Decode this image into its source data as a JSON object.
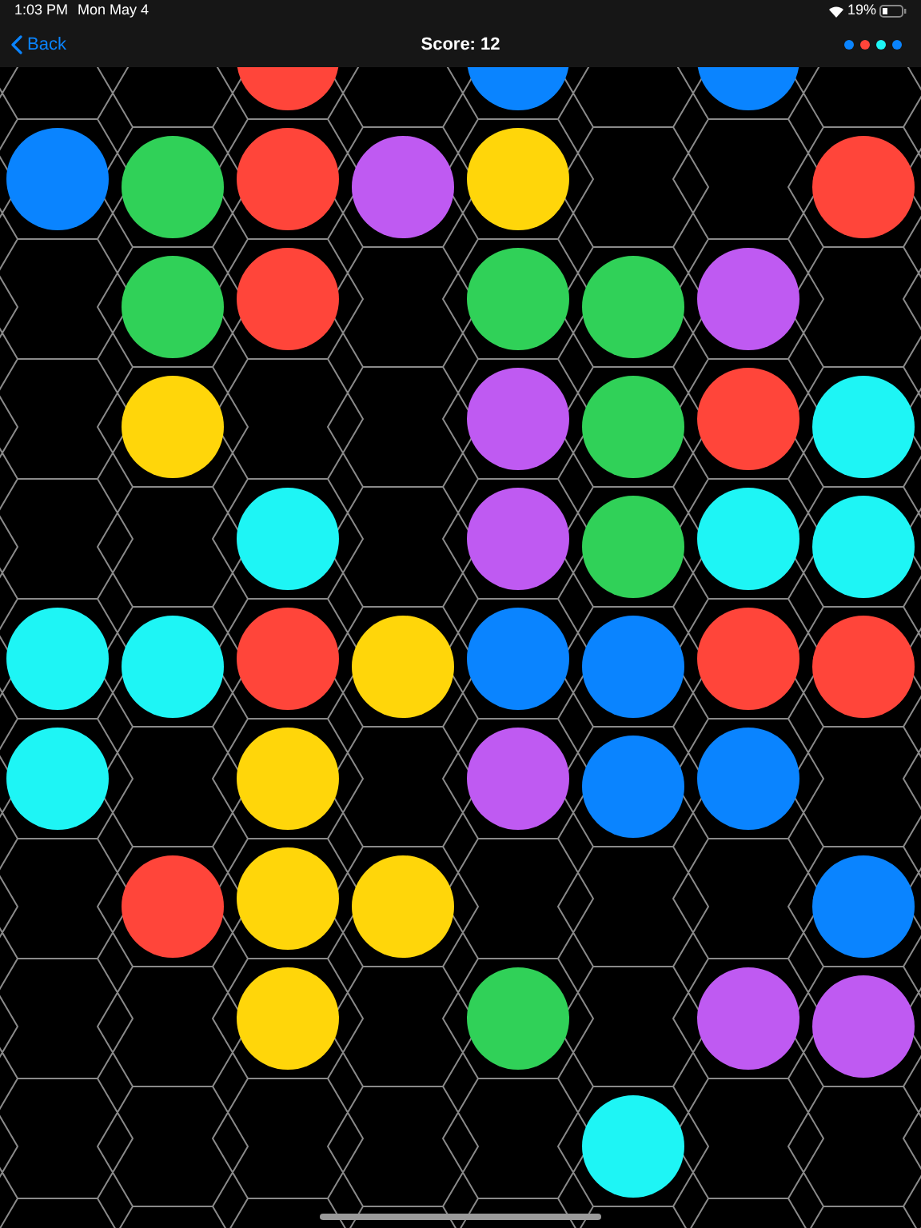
{
  "status_bar": {
    "time": "1:03 PM",
    "date": "Mon May 4",
    "battery": "19%"
  },
  "nav": {
    "back": "Back",
    "title": "Score: 12"
  },
  "next_colors": [
    {
      "color": "#0a84ff"
    },
    {
      "color": "#ff453a"
    },
    {
      "color": "#1ef5f5"
    },
    {
      "color": "#0a84ff"
    }
  ],
  "board": {
    "columns": [
      {
        "cells": [
          {
            "kind": "empty"
          },
          {
            "kind": "ball",
            "color": "#0a84ff"
          },
          {
            "kind": "empty"
          },
          {
            "kind": "empty"
          },
          {
            "kind": "empty"
          },
          {
            "kind": "ball",
            "color": "#1ef5f5"
          },
          {
            "kind": "ball",
            "color": "#1ef5f5"
          }
        ]
      },
      {
        "cells": [
          {
            "kind": "empty"
          },
          {
            "kind": "ball",
            "color": "#30d158"
          },
          {
            "kind": "ball",
            "color": "#30d158"
          },
          {
            "kind": "ball",
            "color": "#ffd60a"
          },
          {
            "kind": "empty"
          },
          {
            "kind": "ball",
            "color": "#1ef5f5"
          },
          {
            "kind": "empty"
          },
          {
            "kind": "ball",
            "color": "#ff453a"
          }
        ]
      },
      {
        "cells": [
          {
            "kind": "ball",
            "color": "#ff453a"
          },
          {
            "kind": "ball",
            "color": "#ff453a"
          },
          {
            "kind": "ball",
            "color": "#ff453a"
          },
          {
            "kind": "empty"
          },
          {
            "kind": "ball",
            "color": "#1ef5f5"
          },
          {
            "kind": "ball",
            "color": "#ff453a"
          },
          {
            "kind": "ball",
            "color": "#ffd60a"
          },
          {
            "kind": "ball",
            "color": "#ffd60a"
          },
          {
            "kind": "ball",
            "color": "#ffd60a"
          }
        ]
      },
      {
        "cells": [
          {
            "kind": "empty"
          },
          {
            "kind": "ball",
            "color": "#bf5af2"
          },
          {
            "kind": "empty"
          },
          {
            "kind": "empty"
          },
          {
            "kind": "empty"
          },
          {
            "kind": "ball",
            "color": "#ffd60a"
          },
          {
            "kind": "empty"
          },
          {
            "kind": "ball",
            "color": "#ffd60a"
          }
        ]
      },
      {
        "cells": [
          {
            "kind": "ball",
            "color": "#0a84ff"
          },
          {
            "kind": "ball",
            "color": "#ffd60a"
          },
          {
            "kind": "ball",
            "color": "#30d158"
          },
          {
            "kind": "ball",
            "color": "#bf5af2"
          },
          {
            "kind": "ball",
            "color": "#bf5af2"
          },
          {
            "kind": "ball",
            "color": "#0a84ff"
          },
          {
            "kind": "ball",
            "color": "#bf5af2"
          },
          {
            "kind": "empty"
          },
          {
            "kind": "ball",
            "color": "#30d158"
          }
        ]
      },
      {
        "cells": [
          {
            "kind": "empty"
          },
          {
            "kind": "empty"
          },
          {
            "kind": "ball",
            "color": "#30d158"
          },
          {
            "kind": "ball",
            "color": "#30d158"
          },
          {
            "kind": "ball",
            "color": "#30d158"
          },
          {
            "kind": "ball",
            "color": "#0a84ff"
          },
          {
            "kind": "ball",
            "color": "#0a84ff"
          },
          {
            "kind": "empty"
          },
          {
            "kind": "empty"
          },
          {
            "kind": "ball",
            "color": "#1ef5f5"
          }
        ]
      },
      {
        "cells": [
          {
            "kind": "ball",
            "color": "#0a84ff"
          },
          {
            "kind": "empty"
          },
          {
            "kind": "ball",
            "color": "#bf5af2"
          },
          {
            "kind": "ball",
            "color": "#ff453a"
          },
          {
            "kind": "ball",
            "color": "#1ef5f5"
          },
          {
            "kind": "ball",
            "color": "#ff453a"
          },
          {
            "kind": "ball",
            "color": "#0a84ff"
          },
          {
            "kind": "empty"
          },
          {
            "kind": "ball",
            "color": "#bf5af2"
          }
        ]
      },
      {
        "cells": [
          {
            "kind": "empty"
          },
          {
            "kind": "ball",
            "color": "#ff453a"
          },
          {
            "kind": "empty"
          },
          {
            "kind": "ball",
            "color": "#1ef5f5"
          },
          {
            "kind": "ball",
            "color": "#1ef5f5"
          },
          {
            "kind": "ball",
            "color": "#ff453a"
          },
          {
            "kind": "empty"
          },
          {
            "kind": "ball",
            "color": "#0a84ff"
          },
          {
            "kind": "ball",
            "color": "#bf5af2"
          }
        ]
      }
    ]
  }
}
